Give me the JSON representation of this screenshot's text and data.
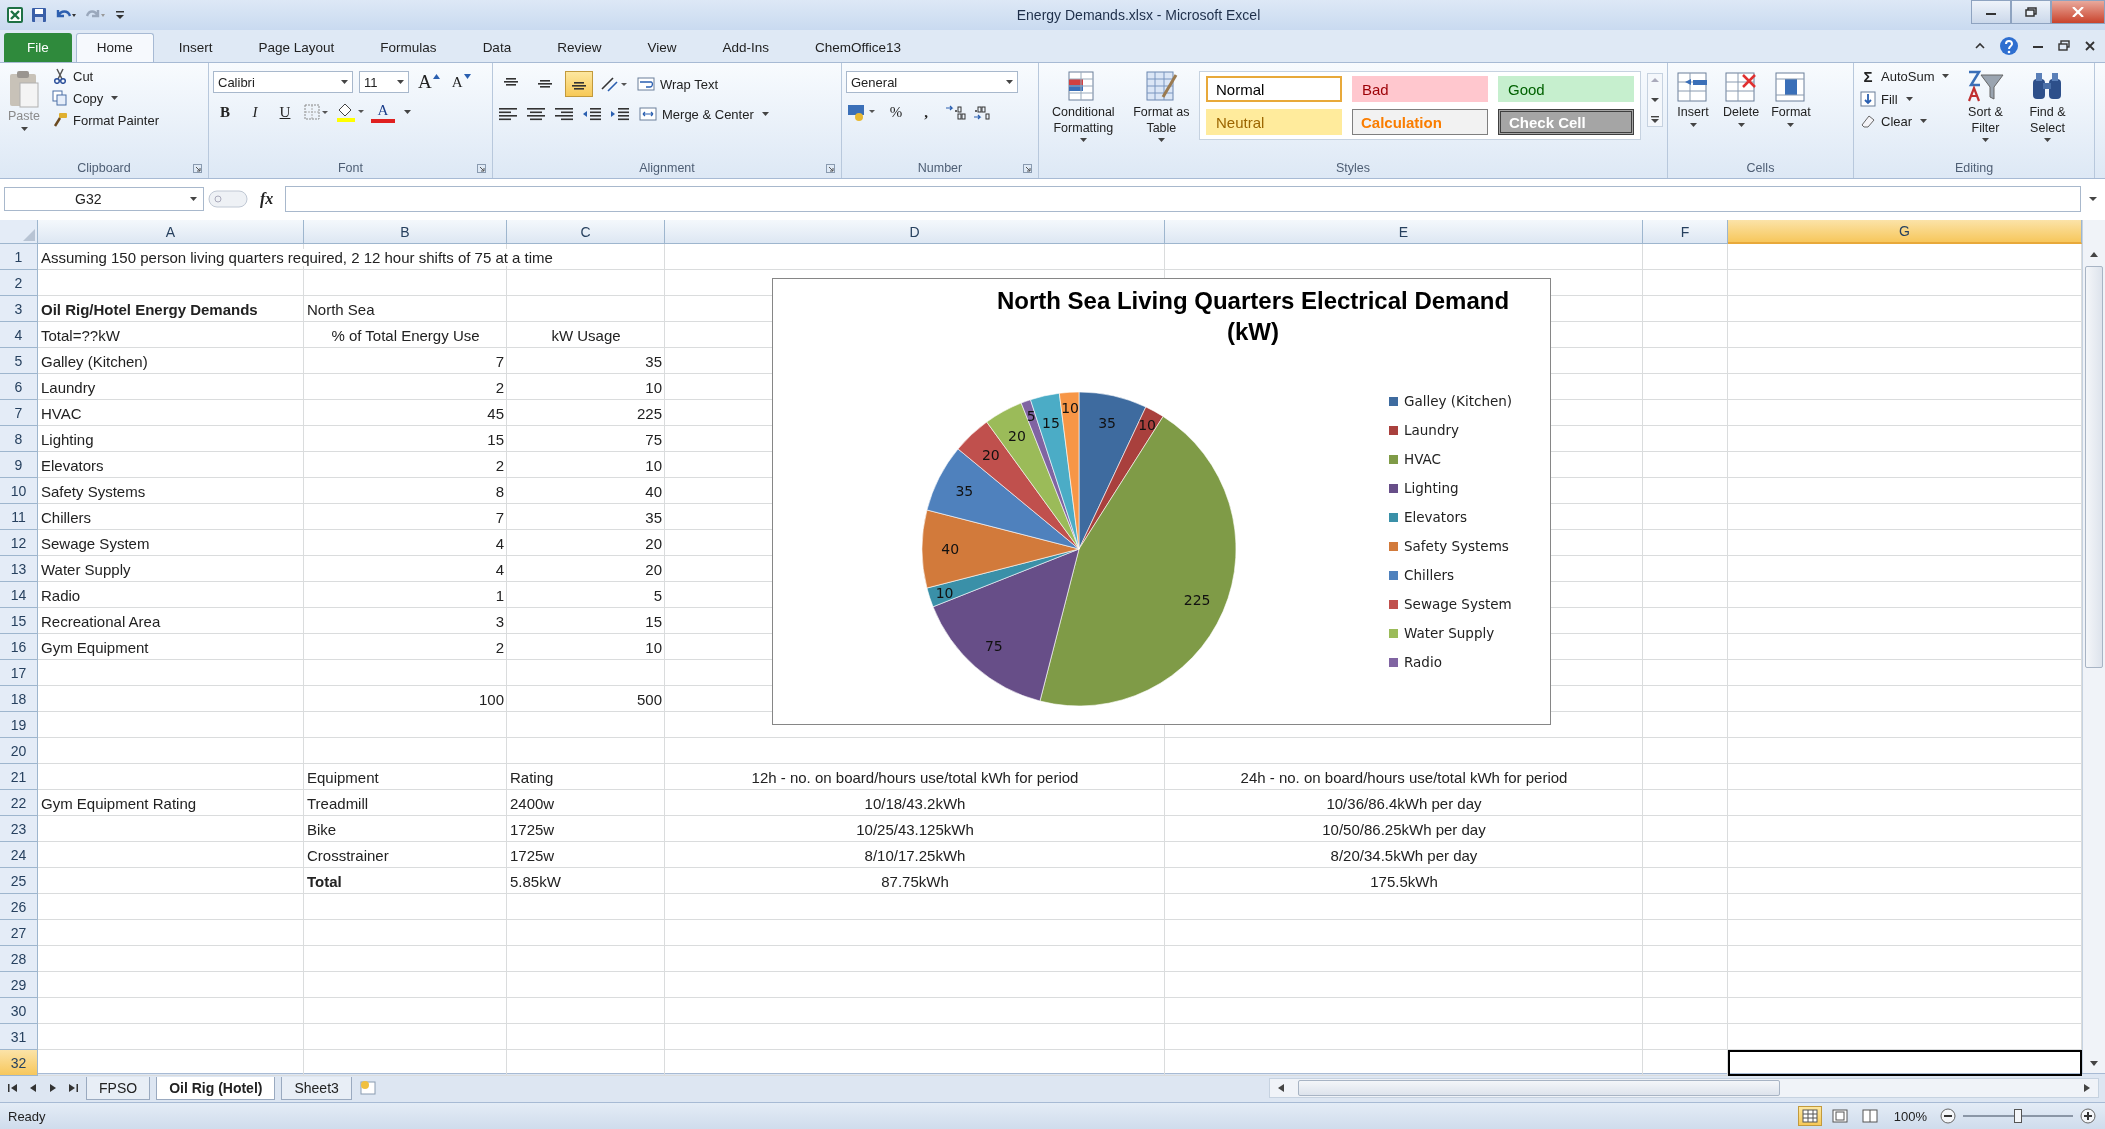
{
  "window": {
    "title": "Energy Demands.xlsx - Microsoft Excel"
  },
  "tabs": [
    {
      "label": "File",
      "kind": "file",
      "selected": false
    },
    {
      "label": "Home",
      "kind": "tab",
      "selected": true
    },
    {
      "label": "Insert",
      "kind": "tab",
      "selected": false
    },
    {
      "label": "Page Layout",
      "kind": "tab",
      "selected": false
    },
    {
      "label": "Formulas",
      "kind": "tab",
      "selected": false
    },
    {
      "label": "Data",
      "kind": "tab",
      "selected": false
    },
    {
      "label": "Review",
      "kind": "tab",
      "selected": false
    },
    {
      "label": "View",
      "kind": "tab",
      "selected": false
    },
    {
      "label": "Add-Ins",
      "kind": "tab",
      "selected": false
    },
    {
      "label": "ChemOffice13",
      "kind": "tab",
      "selected": false
    }
  ],
  "ribbon": {
    "clipboard": {
      "label": "Clipboard",
      "paste": "Paste",
      "cut": "Cut",
      "copy": "Copy",
      "format_painter": "Format Painter"
    },
    "font": {
      "label": "Font",
      "font_name": "Calibri",
      "font_size": "11",
      "grow_font": "A",
      "shrink_font": "A",
      "bold": "B",
      "italic": "I",
      "underline": "U",
      "font_color": "A"
    },
    "alignment": {
      "label": "Alignment",
      "wrap_text": "Wrap Text",
      "merge_center": "Merge & Center",
      "vertical_align": [
        {
          "selected": false
        },
        {
          "selected": false
        },
        {
          "selected": true
        }
      ]
    },
    "number": {
      "label": "Number",
      "format": "General",
      "percent": "%",
      "comma": ","
    },
    "styles": {
      "label": "Styles",
      "conditional_formatting": "Conditional Formatting",
      "format_as_table": "Format as Table",
      "gallery": [
        {
          "label": "Normal",
          "kind": "normal",
          "selected": true
        },
        {
          "label": "Bad",
          "kind": "bad",
          "selected": false
        },
        {
          "label": "Good",
          "kind": "good",
          "selected": false
        },
        {
          "label": "Neutral",
          "kind": "neutral",
          "selected": false
        },
        {
          "label": "Calculation",
          "kind": "calculation",
          "selected": false
        },
        {
          "label": "Check Cell",
          "kind": "check",
          "selected": false
        }
      ]
    },
    "cells": {
      "label": "Cells",
      "insert": "Insert",
      "delete": "Delete",
      "format": "Format"
    },
    "editing": {
      "label": "Editing",
      "sigma": "Σ",
      "autosum": "AutoSum",
      "fill": "Fill",
      "clear": "Clear",
      "sort_filter": "Sort & Filter",
      "find_select": "Find & Select"
    }
  },
  "formula_bar": {
    "name_box": "G32",
    "function_label": "fx"
  },
  "sheet": {
    "columns": [
      {
        "label": "A",
        "selected": false
      },
      {
        "label": "B",
        "selected": false
      },
      {
        "label": "C",
        "selected": false
      },
      {
        "label": "D",
        "selected": false
      },
      {
        "label": "E",
        "selected": false
      },
      {
        "label": "F",
        "selected": false
      },
      {
        "label": "G",
        "selected": true
      }
    ],
    "rows": [
      {
        "number": "1",
        "selected": false,
        "cells": {
          "col_a": {
            "text": "Assuming 150 person living quarters required, 2 12 hour shifts of 75 at a time"
          }
        }
      },
      {
        "number": "2",
        "selected": false
      },
      {
        "number": "3",
        "selected": false,
        "cells": {
          "col_a": {
            "text": "Oil Rig/Hotel Energy Demands",
            "bold": true
          },
          "col_b": {
            "text": "North Sea"
          }
        }
      },
      {
        "number": "4",
        "selected": false,
        "cells": {
          "col_a": {
            "text": "Total=??kW"
          },
          "col_b": {
            "text": "% of Total Energy Use",
            "centered": true
          },
          "col_c": {
            "text": "kW Usage",
            "centered": true
          }
        }
      },
      {
        "number": "5",
        "selected": false,
        "cells": {
          "col_a": {
            "text": "Galley (Kitchen)"
          },
          "col_b": {
            "text": "7",
            "numeric": true
          },
          "col_c": {
            "text": "35",
            "numeric": true
          }
        }
      },
      {
        "number": "6",
        "selected": false,
        "cells": {
          "col_a": {
            "text": "Laundry"
          },
          "col_b": {
            "text": "2",
            "numeric": true
          },
          "col_c": {
            "text": "10",
            "numeric": true
          }
        }
      },
      {
        "number": "7",
        "selected": false,
        "cells": {
          "col_a": {
            "text": "HVAC"
          },
          "col_b": {
            "text": "45",
            "numeric": true
          },
          "col_c": {
            "text": "225",
            "numeric": true
          }
        }
      },
      {
        "number": "8",
        "selected": false,
        "cells": {
          "col_a": {
            "text": "Lighting"
          },
          "col_b": {
            "text": "15",
            "numeric": true
          },
          "col_c": {
            "text": "75",
            "numeric": true
          }
        }
      },
      {
        "number": "9",
        "selected": false,
        "cells": {
          "col_a": {
            "text": "Elevators"
          },
          "col_b": {
            "text": "2",
            "numeric": true
          },
          "col_c": {
            "text": "10",
            "numeric": true
          }
        }
      },
      {
        "number": "10",
        "selected": false,
        "cells": {
          "col_a": {
            "text": "Safety Systems"
          },
          "col_b": {
            "text": "8",
            "numeric": true
          },
          "col_c": {
            "text": "40",
            "numeric": true
          }
        }
      },
      {
        "number": "11",
        "selected": false,
        "cells": {
          "col_a": {
            "text": "Chillers"
          },
          "col_b": {
            "text": "7",
            "numeric": true
          },
          "col_c": {
            "text": "35",
            "numeric": true
          }
        }
      },
      {
        "number": "12",
        "selected": false,
        "cells": {
          "col_a": {
            "text": "Sewage System"
          },
          "col_b": {
            "text": "4",
            "numeric": true
          },
          "col_c": {
            "text": "20",
            "numeric": true
          }
        }
      },
      {
        "number": "13",
        "selected": false,
        "cells": {
          "col_a": {
            "text": "Water Supply"
          },
          "col_b": {
            "text": "4",
            "numeric": true
          },
          "col_c": {
            "text": "20",
            "numeric": true
          }
        }
      },
      {
        "number": "14",
        "selected": false,
        "cells": {
          "col_a": {
            "text": "Radio"
          },
          "col_b": {
            "text": "1",
            "numeric": true
          },
          "col_c": {
            "text": "5",
            "numeric": true
          }
        }
      },
      {
        "number": "15",
        "selected": false,
        "cells": {
          "col_a": {
            "text": "Recreational Area"
          },
          "col_b": {
            "text": "3",
            "numeric": true
          },
          "col_c": {
            "text": "15",
            "numeric": true
          }
        }
      },
      {
        "number": "16",
        "selected": false,
        "cells": {
          "col_a": {
            "text": "Gym Equipment"
          },
          "col_b": {
            "text": "2",
            "numeric": true
          },
          "col_c": {
            "text": "10",
            "numeric": true
          }
        }
      },
      {
        "number": "17",
        "selected": false
      },
      {
        "number": "18",
        "selected": false,
        "cells": {
          "col_b": {
            "text": "100",
            "numeric": true
          },
          "col_c": {
            "text": "500",
            "numeric": true
          }
        }
      },
      {
        "number": "19",
        "selected": false
      },
      {
        "number": "20",
        "selected": false
      },
      {
        "number": "21",
        "selected": false,
        "cells": {
          "col_b": {
            "text": "Equipment"
          },
          "col_c": {
            "text": "Rating"
          },
          "col_d": {
            "text": "12h - no. on board/hours use/total kWh for period",
            "centered": true
          },
          "col_e": {
            "text": "24h - no. on board/hours use/total kWh for period",
            "centered": true
          }
        }
      },
      {
        "number": "22",
        "selected": false,
        "cells": {
          "col_a": {
            "text": "Gym Equipment Rating"
          },
          "col_b": {
            "text": "Treadmill"
          },
          "col_c": {
            "text": "2400w"
          },
          "col_d": {
            "text": "10/18/43.2kWh",
            "centered": true
          },
          "col_e": {
            "text": "10/36/86.4kWh per day",
            "centered": true
          }
        }
      },
      {
        "number": "23",
        "selected": false,
        "cells": {
          "col_b": {
            "text": "Bike"
          },
          "col_c": {
            "text": "1725w"
          },
          "col_d": {
            "text": "10/25/43.125kWh",
            "centered": true
          },
          "col_e": {
            "text": "10/50/86.25kWh per day",
            "centered": true
          }
        }
      },
      {
        "number": "24",
        "selected": false,
        "cells": {
          "col_b": {
            "text": "Crosstrainer"
          },
          "col_c": {
            "text": "1725w"
          },
          "col_d": {
            "text": "8/10/17.25kWh",
            "centered": true
          },
          "col_e": {
            "text": "8/20/34.5kWh per day",
            "centered": true
          }
        }
      },
      {
        "number": "25",
        "selected": false,
        "cells": {
          "col_b": {
            "text": "Total",
            "bold": true
          },
          "col_c": {
            "text": "5.85kW"
          },
          "col_d": {
            "text": "87.75kWh",
            "centered": true
          },
          "col_e": {
            "text": "175.5kWh",
            "centered": true
          }
        }
      },
      {
        "number": "26",
        "selected": false
      },
      {
        "number": "27",
        "selected": false
      },
      {
        "number": "28",
        "selected": false
      },
      {
        "number": "29",
        "selected": false
      },
      {
        "number": "30",
        "selected": false
      },
      {
        "number": "31",
        "selected": false
      },
      {
        "number": "32",
        "selected": true
      }
    ]
  },
  "chart": {
    "chart_data": {
      "type": "pie",
      "title": "North Sea Living Quarters Electrical Demand (kW)",
      "values": [
        35,
        10,
        225,
        75,
        10,
        40,
        35,
        20,
        20,
        5,
        15,
        10
      ],
      "colors": [
        "#3e6b9f",
        "#a9403d",
        "#7f9b47",
        "#674e88",
        "#3a90a8",
        "#d27a3b",
        "#4f81bd",
        "#c0504d",
        "#9bbb59",
        "#8064a2",
        "#4bacc6",
        "#f79646"
      ],
      "data_labels": true
    },
    "legend": [
      {
        "label": "Galley (Kitchen)",
        "color": "#3e6b9f"
      },
      {
        "label": "Laundry",
        "color": "#a9403d"
      },
      {
        "label": "HVAC",
        "color": "#7f9b47"
      },
      {
        "label": "Lighting",
        "color": "#674e88"
      },
      {
        "label": "Elevators",
        "color": "#3a90a8"
      },
      {
        "label": "Safety Systems",
        "color": "#d27a3b"
      },
      {
        "label": "Chillers",
        "color": "#4f81bd"
      },
      {
        "label": "Sewage System",
        "color": "#c0504d"
      },
      {
        "label": "Water Supply",
        "color": "#9bbb59"
      },
      {
        "label": "Radio",
        "color": "#8064a2"
      }
    ]
  },
  "sheet_tabs": [
    {
      "label": "FPSO",
      "selected": false
    },
    {
      "label": "Oil Rig (Hotel)",
      "selected": true
    },
    {
      "label": "Sheet3",
      "selected": false
    }
  ],
  "status_bar": {
    "status": "Ready",
    "views": [
      {
        "kind": "normal",
        "selected": true
      },
      {
        "kind": "page_layout",
        "selected": false
      },
      {
        "kind": "page_break",
        "selected": false
      }
    ],
    "zoom": "100%",
    "zoom_slider": {
      "level": 0.5
    }
  }
}
